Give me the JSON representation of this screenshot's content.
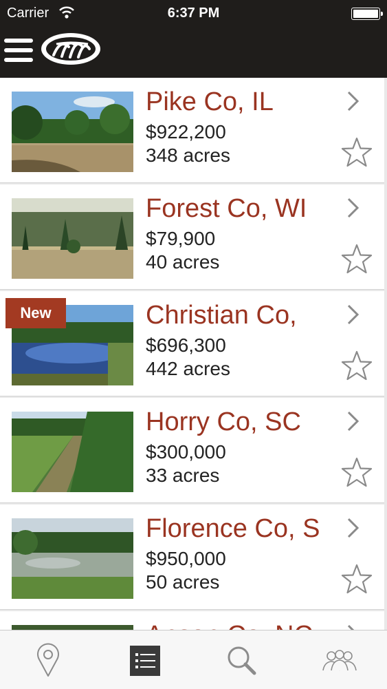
{
  "status": {
    "carrier": "Carrier",
    "time": "6:37 PM"
  },
  "nav": {
    "menu_icon": "hamburger-menu-icon",
    "logo_icon": "bear-paw-logo-icon"
  },
  "listings": [
    {
      "title": "Pike Co, IL",
      "price": "$922,200",
      "acres": "348 acres",
      "is_new": false,
      "badge": ""
    },
    {
      "title": "Forest Co, WI",
      "price": "$79,900",
      "acres": "40 acres",
      "is_new": false,
      "badge": ""
    },
    {
      "title": "Christian Co,",
      "price": "$696,300",
      "acres": "442 acres",
      "is_new": true,
      "badge": "New"
    },
    {
      "title": "Horry Co, SC",
      "price": "$300,000",
      "acres": "33 acres",
      "is_new": false,
      "badge": ""
    },
    {
      "title": "Florence Co, S",
      "price": "$950,000",
      "acres": "50 acres",
      "is_new": false,
      "badge": ""
    },
    {
      "title": "Anson Co, NC",
      "price": "",
      "acres": "",
      "is_new": false,
      "badge": ""
    }
  ],
  "tabs": [
    {
      "icon": "map-pin-icon",
      "active": false
    },
    {
      "icon": "list-icon",
      "active": true
    },
    {
      "icon": "search-icon",
      "active": false
    },
    {
      "icon": "agents-group-icon",
      "active": false
    }
  ],
  "colors": {
    "accent": "#9a3421",
    "bar": "#1f1d1b",
    "badge": "#a33a22"
  }
}
